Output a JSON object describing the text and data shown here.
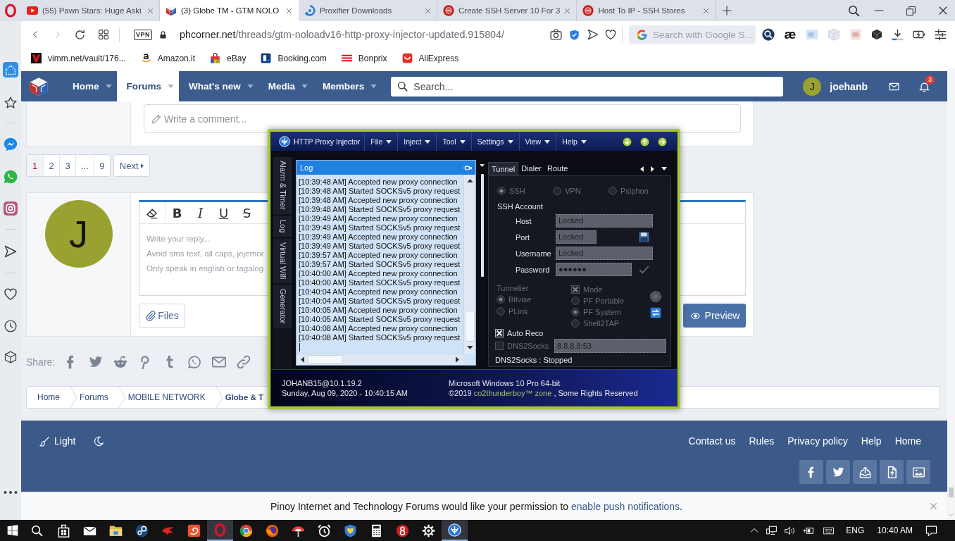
{
  "browser": {
    "tabs": [
      {
        "kind": "play",
        "title": "(55) Pawn Stars: Huge Aski",
        "selected": false
      },
      {
        "kind": "cube",
        "title": "(3) Globe TM - GTM NOLO",
        "selected": true
      },
      {
        "kind": "ring",
        "title": "Proxifier Downloads",
        "selected": false
      },
      {
        "kind": "seal",
        "title": "Create SSH Server 10 For 3",
        "selected": false
      },
      {
        "kind": "seal",
        "title": "Host To IP - SSH Stores",
        "selected": false
      }
    ],
    "address": {
      "badge": "VPN",
      "host": "phcorner.net",
      "path": "/threads/gtm-noloadv16-http-proxy-injector-updated.915804/"
    },
    "search": {
      "placeholder": "Search with Google S..."
    },
    "extension_label": "æ",
    "bookmarks": [
      {
        "kind": "vee",
        "label": "vimm.net/vault/176..."
      },
      {
        "kind": "smile",
        "label": "Amazon.it"
      },
      {
        "kind": "bag",
        "label": "eBay"
      },
      {
        "kind": "tile",
        "label": "Booking.com"
      },
      {
        "kind": "stripes",
        "label": "Bonprix"
      },
      {
        "kind": "basket",
        "label": "AliExpress"
      }
    ]
  },
  "forum": {
    "nav": {
      "items": [
        {
          "label": "Home",
          "selected": false
        },
        {
          "label": "Forums",
          "selected": true
        },
        {
          "label": "What's new",
          "selected": false
        },
        {
          "label": "Media",
          "selected": false
        },
        {
          "label": "Members",
          "selected": false
        }
      ],
      "search": {
        "placeholder": "Search..."
      },
      "user": {
        "initial": "J",
        "name": "joehanb"
      },
      "alerts_count": "3"
    },
    "comment": {
      "placeholder": "Write a comment..."
    },
    "pagination": {
      "pages": [
        {
          "label": "1",
          "selected": true
        },
        {
          "label": "2",
          "selected": false
        },
        {
          "label": "3",
          "selected": false
        },
        {
          "label": "...",
          "selected": false
        },
        {
          "label": "9",
          "selected": false
        }
      ],
      "next": "Next"
    },
    "reply": {
      "avatar_initial": "J",
      "toolbar": [
        {
          "kind": "bold",
          "label": "B"
        },
        {
          "kind": "italic",
          "label": "I"
        },
        {
          "kind": "underline",
          "label": "U"
        },
        {
          "kind": "strike",
          "label": "S"
        }
      ],
      "placeholder_lines": [
        "Write your reply...",
        "Avoid sms text, all caps, jejemor",
        "Only speak in english or tagalog"
      ],
      "files": "Files",
      "preview": "Preview"
    },
    "share": {
      "label": "Share:"
    },
    "breadcrumbs": [
      "Home",
      "Forums",
      "MOBILE NETWORK",
      "Globe & T"
    ],
    "footer": {
      "style_label": "Light",
      "links": [
        "Contact us",
        "Rules",
        "Privacy policy",
        "Help",
        "Home"
      ]
    },
    "push": {
      "text": "Pinoy Internet and Technology Forums would like your permission to",
      "link": "enable push notifications",
      "end": "."
    }
  },
  "injector": {
    "title": "HTTP Proxy Injector",
    "menus": [
      "File",
      "Inject",
      "Tool",
      "Settings",
      "View",
      "Help"
    ],
    "side_tabs": [
      "Alarm & Timer",
      "Log",
      "Virtual Wifi",
      "Generator"
    ],
    "log": {
      "title": "Log",
      "lines": [
        "[10:39:48 AM] Accepted new proxy connection",
        "[10:39:48 AM] Started SOCKSv5 proxy request",
        "[10:39:48 AM] Accepted new proxy connection",
        "[10:39:48 AM] Started SOCKSv5 proxy request",
        "[10:39:49 AM] Accepted new proxy connection",
        "[10:39:49 AM] Started SOCKSv5 proxy request",
        "[10:39:49 AM] Accepted new proxy connection",
        "[10:39:49 AM] Started SOCKSv5 proxy request",
        "[10:39:57 AM] Accepted new proxy connection",
        "[10:39:57 AM] Started SOCKSv5 proxy request",
        "[10:40:00 AM] Accepted new proxy connection",
        "[10:40:00 AM] Started SOCKSv5 proxy request",
        "[10:40:04 AM] Accepted new proxy connection",
        "[10:40:04 AM] Started SOCKSv5 proxy request",
        "[10:40:05 AM] Accepted new proxy connection",
        "[10:40:05 AM] Started SOCKSv5 proxy request",
        "[10:40:08 AM] Accepted new proxy connection",
        "[10:40:08 AM] Started SOCKSv5 proxy request"
      ]
    },
    "tabs": [
      {
        "label": "Tunnel",
        "selected": true
      },
      {
        "label": "Dialer",
        "selected": false
      },
      {
        "label": "Route",
        "selected": false
      }
    ],
    "connection_types": [
      {
        "label": "SSH",
        "selected": true,
        "disabled": true
      },
      {
        "label": "VPN",
        "selected": false,
        "disabled": true
      },
      {
        "label": "Psiphon",
        "selected": false,
        "disabled": true
      }
    ],
    "account": {
      "title": "SSH Account",
      "fields": [
        {
          "label": "Host",
          "value": "Locked"
        },
        {
          "label": "Port",
          "value": "Locked"
        },
        {
          "label": "Username",
          "value": "Locked"
        },
        {
          "label": "Password",
          "value": "●●●●●●"
        }
      ]
    },
    "tunnelier": {
      "title": "Tunnelier",
      "disabled": true,
      "options": [
        {
          "label": "Bitvise",
          "selected": true
        },
        {
          "label": "PLink",
          "selected": false
        }
      ]
    },
    "mode": {
      "label": "Mode",
      "checked": true,
      "disabled": true,
      "options": [
        {
          "label": "PF Portable",
          "selected": false
        },
        {
          "label": "PF System",
          "selected": true
        },
        {
          "label": "Shell2TAP",
          "selected": false
        }
      ]
    },
    "auto_reco": {
      "label": "Auto Reco",
      "checked": true,
      "disabled": false
    },
    "dns2socks": {
      "label": "DNS2Socks",
      "checked": false,
      "disabled": true,
      "value": "8.8.8.8:53"
    },
    "status": "DNS2Socks : Stopped",
    "footer": {
      "user": "JOHANB15@10.1.19.2",
      "datetime": "Sunday, Aug 09, 2020 - 10:40:15 AM",
      "os": "Microsoft Windows 10 Pro 64-bit",
      "copyright": {
        "before": "©2019",
        "link": "co2thunderboy™ zone",
        "after": ", Some Rights Reserved"
      }
    }
  },
  "taskbar": {
    "apps": [
      {
        "kind": "store",
        "active": false
      },
      {
        "kind": "mail",
        "active": false
      },
      {
        "kind": "folder",
        "active": false
      },
      {
        "kind": "steam",
        "active": false
      },
      {
        "kind": "wing",
        "active": false
      },
      {
        "kind": "swirl",
        "active": false
      },
      {
        "kind": "opera",
        "active": true
      },
      {
        "kind": "chrome",
        "active": false
      },
      {
        "kind": "firefox",
        "active": false
      },
      {
        "kind": "umbrella",
        "active": false
      },
      {
        "kind": "clock",
        "active": false
      },
      {
        "kind": "shield",
        "active": false
      },
      {
        "kind": "calculator",
        "active": false
      },
      {
        "kind": "rings",
        "active": false
      },
      {
        "kind": "gear",
        "active": false
      },
      {
        "kind": "injector",
        "active": true
      }
    ],
    "language": "ENG",
    "time": "10:40 AM"
  }
}
